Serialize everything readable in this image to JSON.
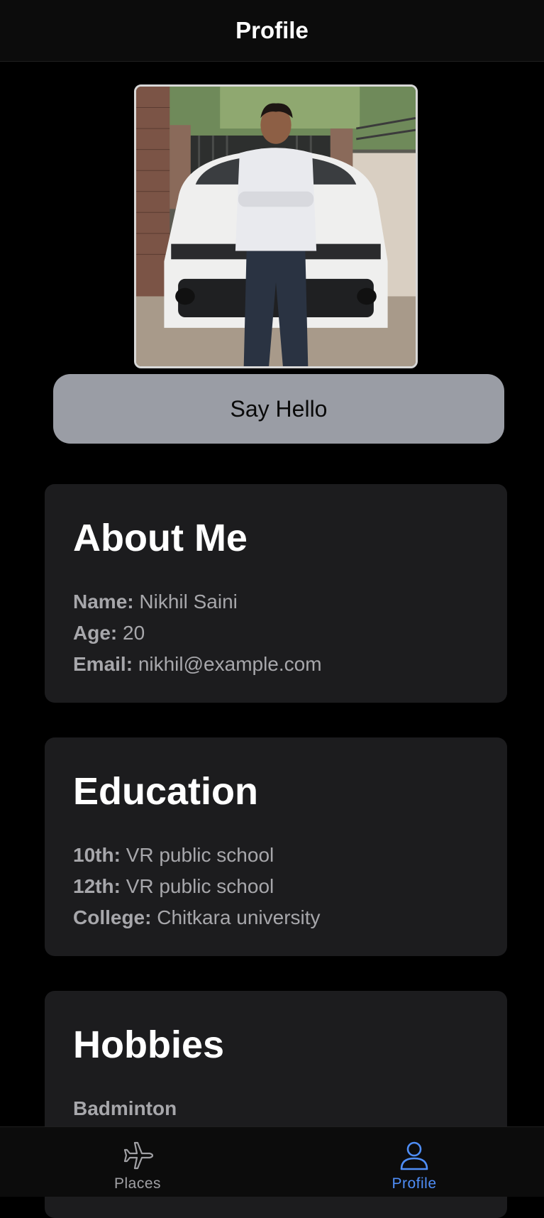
{
  "header": {
    "title": "Profile"
  },
  "hello_button": {
    "label": "Say Hello"
  },
  "about": {
    "title": "About Me",
    "rows": [
      {
        "key": "Name:",
        "value": "Nikhil Saini"
      },
      {
        "key": "Age:",
        "value": "20"
      },
      {
        "key": "Email:",
        "value": "nikhil@example.com"
      }
    ]
  },
  "education": {
    "title": "Education",
    "rows": [
      {
        "key": "10th:",
        "value": "VR public school"
      },
      {
        "key": "12th:",
        "value": "VR public school"
      },
      {
        "key": "College:",
        "value": "Chitkara university"
      }
    ]
  },
  "hobbies": {
    "title": "Hobbies",
    "items": [
      "Badminton"
    ]
  },
  "tabs": [
    {
      "label": "Places",
      "icon": "airplane-icon",
      "active": false
    },
    {
      "label": "Profile",
      "icon": "person-icon",
      "active": true
    }
  ],
  "colors": {
    "accent": "#4f8ef7",
    "card_bg": "#1c1c1e",
    "button_bg": "#9a9da5",
    "muted_text": "#a7a7ab"
  }
}
